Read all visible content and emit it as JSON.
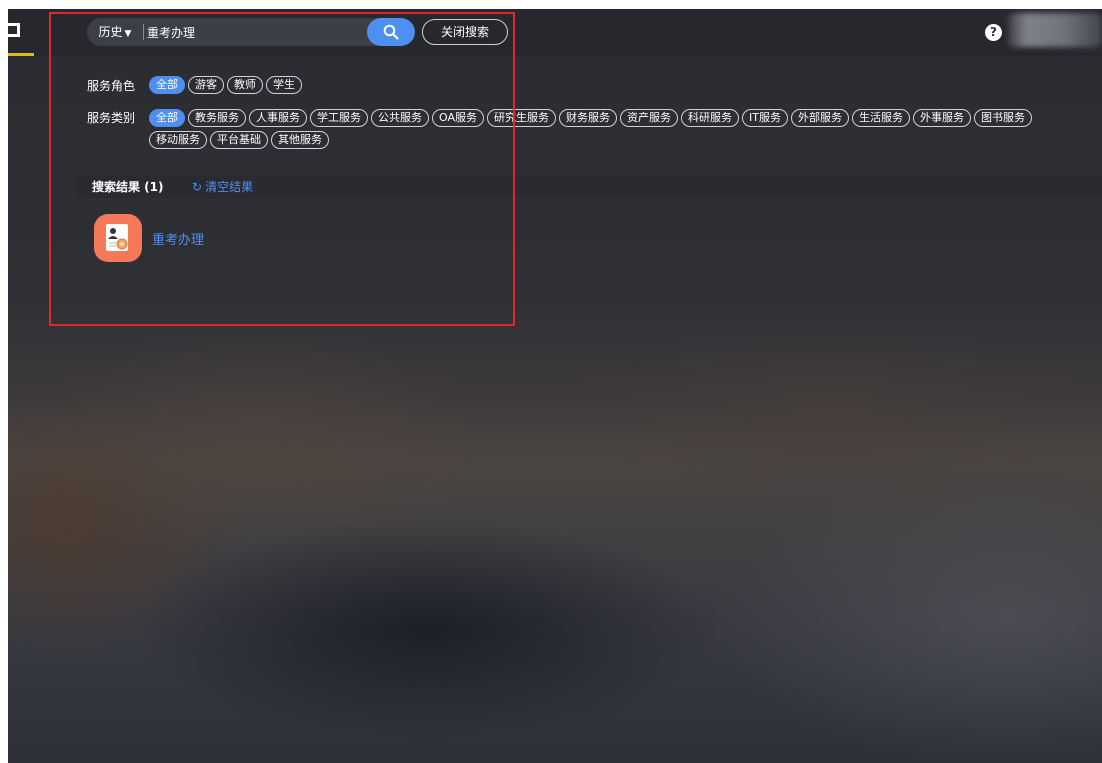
{
  "search": {
    "history_label": "历史",
    "query": "重考办理",
    "close_label": "关闭搜索"
  },
  "filters": {
    "roles": {
      "label": "服务角色",
      "options": [
        "全部",
        "游客",
        "教师",
        "学生"
      ],
      "selected": "全部"
    },
    "categories": {
      "label": "服务类别",
      "options": [
        "全部",
        "教务服务",
        "人事服务",
        "学工服务",
        "公共服务",
        "OA服务",
        "研究生服务",
        "财务服务",
        "资产服务",
        "科研服务",
        "IT服务",
        "外部服务",
        "生活服务",
        "外事服务",
        "图书服务",
        "移动服务",
        "平台基础",
        "其他服务"
      ],
      "selected": "全部"
    }
  },
  "results": {
    "title": "搜索结果 (1)",
    "clear_label": "清空结果",
    "items": [
      {
        "name": "重考办理",
        "icon": "document-certificate-icon"
      }
    ]
  },
  "colors": {
    "accent": "#4e8ff1",
    "highlight_box": "#e0272a",
    "logo_underline": "#e2b81f",
    "app_icon_bg": "#f4795a"
  }
}
